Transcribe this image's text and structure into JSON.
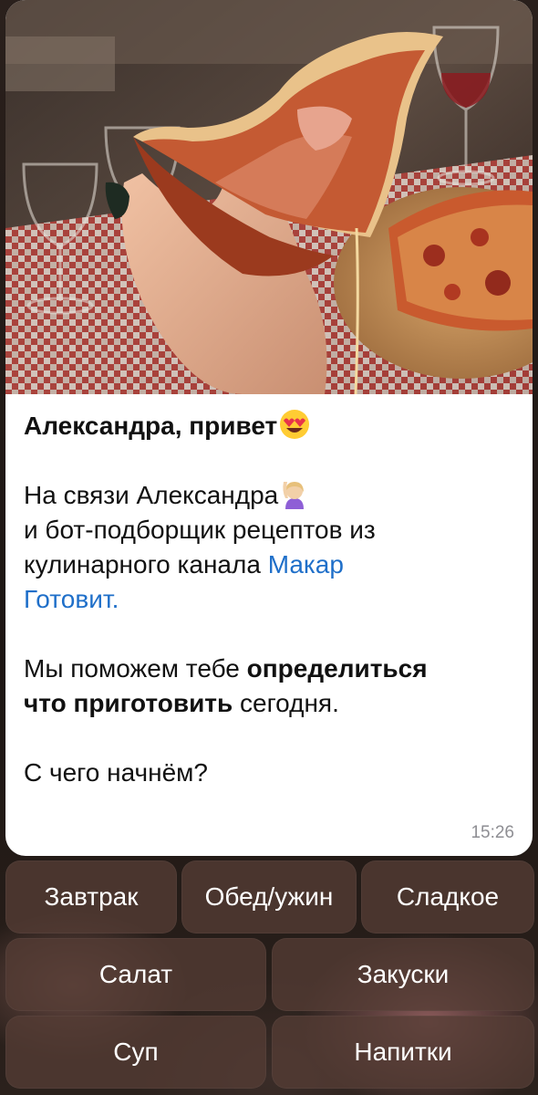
{
  "message": {
    "image_alt": "Slice of pizza held in hand",
    "title": "Александра, привет",
    "title_emoji": "heart-eyes-emoji",
    "p1_line1": "На связи Александра",
    "p1_emoji": "woman-raising-hand-emoji",
    "p1_line2": "и бот-подборщик рецептов из",
    "p1_line3": "кулинарного канала ",
    "channel_link_part1": "Макар",
    "channel_link_part2": "Готовит.",
    "p2_part1": "Мы поможем тебе ",
    "p2_bold1": "определиться",
    "p2_bold2": "что приготовить",
    "p2_part2": " сегодня.",
    "p3": "С чего начнём?",
    "time": "15:26"
  },
  "keyboard": {
    "row1": [
      "Завтрак",
      "Обед/ужин",
      "Сладкое"
    ],
    "row2": [
      "Салат",
      "Закуски"
    ],
    "row3": [
      "Суп",
      "Напитки"
    ]
  },
  "colors": {
    "link": "#1f6fc9",
    "button_bg": "#543c34",
    "bubble_bg": "#ffffff",
    "time": "#8e8e93"
  }
}
